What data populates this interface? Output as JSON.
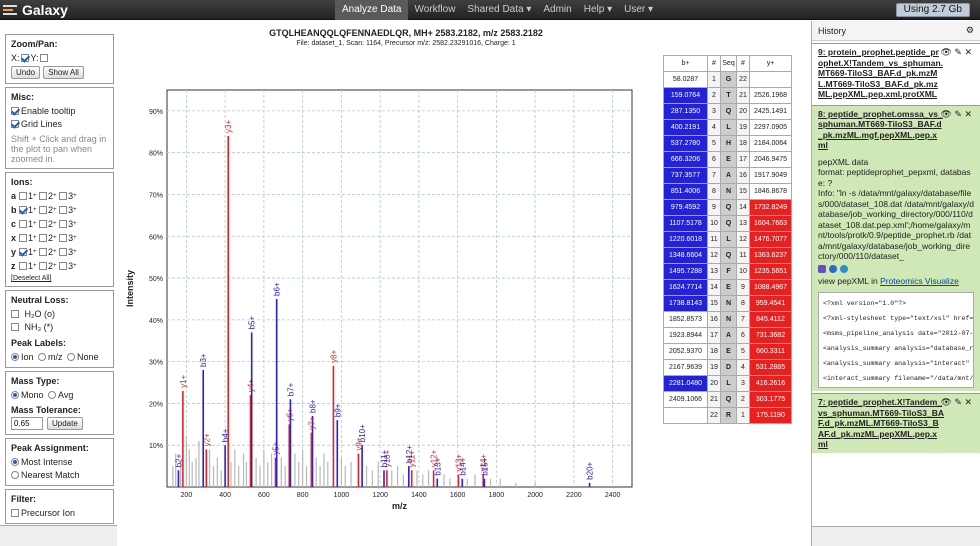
{
  "app": {
    "brand": "Galaxy",
    "usage": "Using 2.7 Gb"
  },
  "nav": [
    {
      "label": "Analyze Data",
      "active": true
    },
    {
      "label": "Workflow"
    },
    {
      "label": "Shared Data ▾"
    },
    {
      "label": "Admin"
    },
    {
      "label": "Help ▾"
    },
    {
      "label": "User ▾"
    }
  ],
  "plot": {
    "title": "GTQLHEANQQLQFENNAEDLQR, MH+ 2583.2182, m/z 2583.2182",
    "subtitle": "File: dataset_1, Scan: 1164, Precursor m/z: 2582.23291016, Charge: 1"
  },
  "tools": {
    "zoom_title": "Zoom/Pan:",
    "x_label": "X:",
    "y_label": "Y:",
    "undo": "Undo",
    "show_all": "Show All",
    "misc_title": "Misc:",
    "tooltip": "Enable tooltip",
    "grid": "Grid Lines",
    "hint": "Shift + Click and drag in the plot to pan when zoomed in.",
    "ions_title": "Ions:",
    "ion_rows": [
      "a",
      "b",
      "c",
      "x",
      "y",
      "z"
    ],
    "deselect": "[Deselect All]",
    "neutral_title": "Neutral Loss:",
    "h2o": "H₂O (o)",
    "nh3": "NH₃ (*)",
    "peak_title": "Peak Labels:",
    "peak_ion": "Ion",
    "peak_mz": "m/z",
    "peak_none": "None",
    "mass_title": "Mass Type:",
    "mono": "Mono",
    "avg": "Avg",
    "tol_title": "Mass Tolerance:",
    "tol_value": "0.65",
    "update": "Update",
    "assign_title": "Peak Assignment:",
    "most": "Most Intense",
    "nearest": "Nearest Match",
    "filter_title": "Filter:",
    "precursor": "Precursor Ion"
  },
  "colors": {
    "b_ion": "#2222d8",
    "y_ion": "#e82020",
    "gray_peak": "#b8b8b8",
    "grid": "#a8c8ec"
  },
  "chart_data": {
    "type": "bar",
    "xlabel": "m/z",
    "ylabel": "Intensity",
    "xlim": [
      100,
      2500
    ],
    "ylim": [
      0,
      95
    ],
    "xticks": [
      "200",
      "400",
      "600",
      "800",
      "1000",
      "1200",
      "1400",
      "1600",
      "1800",
      "2000",
      "2200",
      "2400"
    ],
    "yticks": [
      "10%",
      "20%",
      "30%",
      "40%",
      "50%",
      "60%",
      "70%",
      "80%",
      "90%"
    ],
    "grid": true,
    "labeled_peaks": [
      {
        "mz": 159,
        "i": 4,
        "label": "b2+",
        "ion": "b"
      },
      {
        "mz": 182,
        "i": 23,
        "label": "y1+",
        "ion": "y"
      },
      {
        "mz": 287,
        "i": 28,
        "label": "b3+",
        "ion": "b"
      },
      {
        "mz": 303,
        "i": 9,
        "label": "y2+",
        "ion": "y"
      },
      {
        "mz": 400,
        "i": 10,
        "label": "b4+",
        "ion": "b"
      },
      {
        "mz": 416,
        "i": 84,
        "label": "y3+",
        "ion": "y"
      },
      {
        "mz": 531,
        "i": 22,
        "label": "y4+",
        "ion": "y"
      },
      {
        "mz": 537,
        "i": 37,
        "label": "b5+",
        "ion": "b"
      },
      {
        "mz": 660,
        "i": 7,
        "label": "y5+",
        "ion": "y"
      },
      {
        "mz": 666,
        "i": 45,
        "label": "b6+",
        "ion": "b"
      },
      {
        "mz": 731,
        "i": 15,
        "label": "y6+",
        "ion": "y"
      },
      {
        "mz": 737,
        "i": 21,
        "label": "b7+",
        "ion": "b"
      },
      {
        "mz": 851,
        "i": 17,
        "label": "b8+",
        "ion": "b"
      },
      {
        "mz": 845,
        "i": 13,
        "label": "y7+",
        "ion": "y"
      },
      {
        "mz": 959,
        "i": 29,
        "label": "y8+",
        "ion": "y"
      },
      {
        "mz": 979,
        "i": 16,
        "label": "b9+",
        "ion": "b"
      },
      {
        "mz": 1088,
        "i": 8,
        "label": "y9+",
        "ion": "y"
      },
      {
        "mz": 1107,
        "i": 10,
        "label": "b10+",
        "ion": "b"
      },
      {
        "mz": 1235,
        "i": 4,
        "label": "y10+",
        "ion": "y"
      },
      {
        "mz": 1220,
        "i": 4,
        "label": "b11+",
        "ion": "b"
      },
      {
        "mz": 1348,
        "i": 5,
        "label": "b12+",
        "ion": "b"
      },
      {
        "mz": 1363,
        "i": 4,
        "label": "y11+",
        "ion": "y"
      },
      {
        "mz": 1476,
        "i": 4,
        "label": "y12+",
        "ion": "y"
      },
      {
        "mz": 1495,
        "i": 2,
        "label": "b13+",
        "ion": "b"
      },
      {
        "mz": 1604,
        "i": 3,
        "label": "y13+",
        "ion": "y"
      },
      {
        "mz": 1624,
        "i": 2,
        "label": "b14+",
        "ion": "b"
      },
      {
        "mz": 1732,
        "i": 3,
        "label": "y14+",
        "ion": "y"
      },
      {
        "mz": 1738,
        "i": 2,
        "label": "b15+",
        "ion": "b"
      },
      {
        "mz": 2281,
        "i": 1,
        "label": "b20+",
        "ion": "b"
      }
    ],
    "background_peaks": [
      {
        "mz": 130,
        "i": 5
      },
      {
        "mz": 145,
        "i": 8
      },
      {
        "mz": 170,
        "i": 6
      },
      {
        "mz": 200,
        "i": 12
      },
      {
        "mz": 215,
        "i": 9
      },
      {
        "mz": 230,
        "i": 6
      },
      {
        "mz": 250,
        "i": 7
      },
      {
        "mz": 265,
        "i": 11
      },
      {
        "mz": 320,
        "i": 9
      },
      {
        "mz": 340,
        "i": 5
      },
      {
        "mz": 360,
        "i": 7
      },
      {
        "mz": 380,
        "i": 4
      },
      {
        "mz": 430,
        "i": 6
      },
      {
        "mz": 450,
        "i": 9
      },
      {
        "mz": 470,
        "i": 5
      },
      {
        "mz": 495,
        "i": 8
      },
      {
        "mz": 510,
        "i": 6
      },
      {
        "mz": 560,
        "i": 7
      },
      {
        "mz": 580,
        "i": 5
      },
      {
        "mz": 600,
        "i": 9
      },
      {
        "mz": 620,
        "i": 6
      },
      {
        "mz": 640,
        "i": 8
      },
      {
        "mz": 690,
        "i": 7
      },
      {
        "mz": 710,
        "i": 5
      },
      {
        "mz": 760,
        "i": 8
      },
      {
        "mz": 780,
        "i": 6
      },
      {
        "mz": 800,
        "i": 9
      },
      {
        "mz": 820,
        "i": 5
      },
      {
        "mz": 870,
        "i": 7
      },
      {
        "mz": 890,
        "i": 5
      },
      {
        "mz": 910,
        "i": 8
      },
      {
        "mz": 930,
        "i": 6
      },
      {
        "mz": 1000,
        "i": 7
      },
      {
        "mz": 1020,
        "i": 5
      },
      {
        "mz": 1050,
        "i": 6
      },
      {
        "mz": 1130,
        "i": 5
      },
      {
        "mz": 1160,
        "i": 4
      },
      {
        "mz": 1190,
        "i": 6
      },
      {
        "mz": 1260,
        "i": 4
      },
      {
        "mz": 1290,
        "i": 5
      },
      {
        "mz": 1320,
        "i": 3
      },
      {
        "mz": 1390,
        "i": 4
      },
      {
        "mz": 1420,
        "i": 3
      },
      {
        "mz": 1450,
        "i": 4
      },
      {
        "mz": 1530,
        "i": 3
      },
      {
        "mz": 1560,
        "i": 2
      },
      {
        "mz": 1650,
        "i": 2
      },
      {
        "mz": 1690,
        "i": 3
      },
      {
        "mz": 1770,
        "i": 2
      },
      {
        "mz": 1820,
        "i": 2
      },
      {
        "mz": 1900,
        "i": 1
      },
      {
        "mz": 2000,
        "i": 1
      }
    ]
  },
  "ion_table": {
    "headers": [
      "b+",
      "#",
      "Seq",
      "#",
      "y+"
    ],
    "rows": [
      {
        "b": "58.0287",
        "n1": "1",
        "seq": "G",
        "n2": "22",
        "y": "",
        "bh": false,
        "yh": false
      },
      {
        "b": "159.0764",
        "n1": "2",
        "seq": "T",
        "n2": "21",
        "y": "2526.1968",
        "bh": true,
        "yh": false
      },
      {
        "b": "287.1350",
        "n1": "3",
        "seq": "Q",
        "n2": "20",
        "y": "2425.1491",
        "bh": true,
        "yh": false
      },
      {
        "b": "400.2191",
        "n1": "4",
        "seq": "L",
        "n2": "19",
        "y": "2297.0905",
        "bh": true,
        "yh": false
      },
      {
        "b": "537.2780",
        "n1": "5",
        "seq": "H",
        "n2": "18",
        "y": "2184.0064",
        "bh": true,
        "yh": false
      },
      {
        "b": "666.3206",
        "n1": "6",
        "seq": "E",
        "n2": "17",
        "y": "2046.9475",
        "bh": true,
        "yh": false
      },
      {
        "b": "737.3577",
        "n1": "7",
        "seq": "A",
        "n2": "16",
        "y": "1917.9049",
        "bh": true,
        "yh": false
      },
      {
        "b": "851.4006",
        "n1": "8",
        "seq": "N",
        "n2": "15",
        "y": "1846.8678",
        "bh": true,
        "yh": false
      },
      {
        "b": "979.4592",
        "n1": "9",
        "seq": "Q",
        "n2": "14",
        "y": "1732.8249",
        "bh": true,
        "yh": true
      },
      {
        "b": "1107.5178",
        "n1": "10",
        "seq": "Q",
        "n2": "13",
        "y": "1604.7663",
        "bh": true,
        "yh": true
      },
      {
        "b": "1220.6018",
        "n1": "11",
        "seq": "L",
        "n2": "12",
        "y": "1476.7077",
        "bh": true,
        "yh": true
      },
      {
        "b": "1348.6604",
        "n1": "12",
        "seq": "Q",
        "n2": "11",
        "y": "1363.6237",
        "bh": true,
        "yh": true
      },
      {
        "b": "1495.7288",
        "n1": "13",
        "seq": "F",
        "n2": "10",
        "y": "1235.5651",
        "bh": true,
        "yh": true
      },
      {
        "b": "1624.7714",
        "n1": "14",
        "seq": "E",
        "n2": "9",
        "y": "1088.4967",
        "bh": true,
        "yh": true
      },
      {
        "b": "1738.8143",
        "n1": "15",
        "seq": "N",
        "n2": "8",
        "y": "959.4541",
        "bh": true,
        "yh": true
      },
      {
        "b": "1852.8573",
        "n1": "16",
        "seq": "N",
        "n2": "7",
        "y": "845.4112",
        "bh": false,
        "yh": true
      },
      {
        "b": "1923.8944",
        "n1": "17",
        "seq": "A",
        "n2": "6",
        "y": "731.3682",
        "bh": false,
        "yh": true
      },
      {
        "b": "2052.9370",
        "n1": "18",
        "seq": "E",
        "n2": "5",
        "y": "660.3311",
        "bh": false,
        "yh": true
      },
      {
        "b": "2167.9639",
        "n1": "19",
        "seq": "D",
        "n2": "4",
        "y": "531.2885",
        "bh": false,
        "yh": true
      },
      {
        "b": "2281.0480",
        "n1": "20",
        "seq": "L",
        "n2": "3",
        "y": "416.2616",
        "bh": true,
        "yh": true
      },
      {
        "b": "2409.1066",
        "n1": "21",
        "seq": "Q",
        "n2": "2",
        "y": "303.1775",
        "bh": false,
        "yh": true
      },
      {
        "b": "",
        "n1": "22",
        "seq": "R",
        "n2": "1",
        "y": "175.1190",
        "bh": false,
        "yh": true
      }
    ]
  },
  "history": {
    "title": "History",
    "d9": {
      "title": "9: protein_prophet.peptide_prophet.X!Tandem_vs_sphuman.MT669-TiloS3_BAF.d_pk.mzML.MT669-TiloS3_BAF.d_pk.mzML.pepXML.pep.xml.protXML"
    },
    "d8": {
      "title": "8: peptide_prophet.omssa_vs_sphuman.MT669-TiloS3_BAF.d_pk.mzML.mgf.pepXML.pep.xml",
      "format_line1": "pepXML data",
      "format_line2": "format: peptideprophet_pepxml, database: ?",
      "info": "Info: \"ln -s /data/mnt/galaxy/database/files/000/dataset_108.dat /data/mnt/galaxy/database/job_working_directory/000/110/dataset_108.dat.pep.xml';/home/galaxy/mnt/tools/protk/0.9/peptide_prophet.rb /data/mnt/galaxy/database/job_working_directory/000/110/dataset_",
      "view_prefix": "view pepXML in",
      "view_link": "Proteomics Visualize",
      "preview": [
        "<?xml version=\"1.0\"?>",
        "<?xml-stylesheet type=\"text/xsl\" href=\"",
        "<msms_pipeline_analysis date=\"2012-07-",
        "<analysis_summary analysis=\"database_r",
        "<analysis_summary analysis=\"interact\"",
        "<interact_summary filename=\"/data/mnt/"
      ]
    },
    "d7": {
      "title": "7: peptide_prophet.X!Tandem_vs_sphuman.MT669-TiloS3_BAF.d_pk.mzML.MT669-TiloS3_BAF.d_pk.mzML.pepXML.pep.xml"
    }
  }
}
